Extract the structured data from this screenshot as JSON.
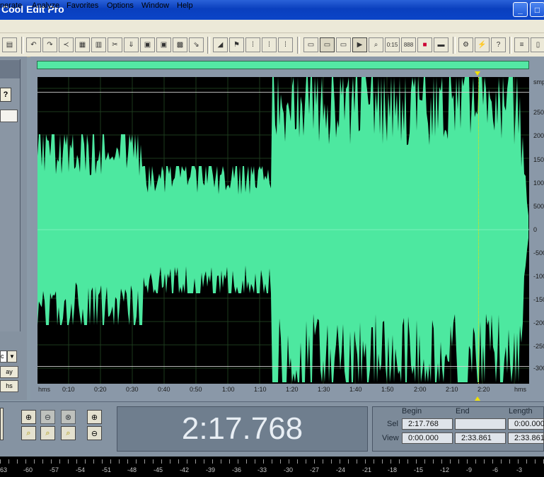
{
  "app": {
    "title": "Cool Edit Pro"
  },
  "window_controls": {
    "minimize": "_",
    "maximize": "□"
  },
  "menu": [
    "nerate",
    "Analyze",
    "Favorites",
    "Options",
    "Window",
    "Help"
  ],
  "colors": {
    "waveform": "#4de8a0",
    "background": "#000000",
    "frame": "#8a98a8"
  },
  "toolbar_icons": [
    "save-icon",
    "undo-icon",
    "redo-icon",
    "repeat-icon",
    "copy-icon",
    "copy-new-icon",
    "cut-icon",
    "paste-icon",
    "paste-new-icon",
    "mix-paste-icon",
    "paste-mono-icon",
    "trim-icon",
    "envelope-icon",
    "flag-icon",
    "grid1-icon",
    "grid2-icon",
    "grid3-icon",
    "multitrack-view-icon",
    "edit-view-icon",
    "cd-view-icon",
    "play-icon",
    "zoom-icon",
    "time-icon",
    "samples-icon",
    "spectral-icon",
    "view-icon",
    "settings-icon",
    "bolt-icon",
    "help-icon",
    "levels-icon"
  ],
  "left_panel": {
    "help": "?",
    "combo_value": "c",
    "play_label": "ay",
    "tab_label": "hs"
  },
  "vertical_axis": {
    "unit": "smp",
    "labels": [
      "2500",
      "2000",
      "1500",
      "1000",
      "500",
      "0",
      "-500",
      "-1000",
      "-1500",
      "-2000",
      "-2500",
      "-300"
    ]
  },
  "time_axis": {
    "start_label": "hms",
    "end_label": "hms",
    "labels": [
      "0:10",
      "0:20",
      "0:30",
      "0:40",
      "0:50",
      "1:00",
      "1:10",
      "1:20",
      "1:30",
      "1:40",
      "1:50",
      "2:00",
      "2:10",
      "2:20"
    ]
  },
  "current_time": "2:17.768",
  "selection": {
    "headers": [
      "Begin",
      "End",
      "Length"
    ],
    "sel_label": "Sel",
    "view_label": "View",
    "sel_begin": "2:17.768",
    "sel_end": "",
    "sel_length": "0:00.000",
    "view_begin": "0:00.000",
    "view_end": "2:33.861",
    "view_length": "2:33.861"
  },
  "meter_labels": [
    "63",
    "-60",
    "-57",
    "-54",
    "-51",
    "-48",
    "-45",
    "-42",
    "-39",
    "-36",
    "-33",
    "-30",
    "-27",
    "-24",
    "-21",
    "-18",
    "-15",
    "-12",
    "-9",
    "-6",
    "-3"
  ]
}
